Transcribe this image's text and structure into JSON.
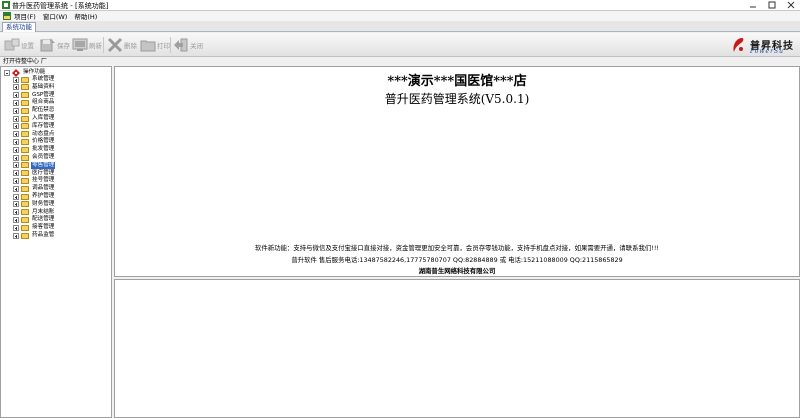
{
  "window": {
    "title": "普升医药管理系统 - [系统功能]"
  },
  "menubar": {
    "items": [
      "项目(F)",
      "窗口(W)",
      "帮助(H)"
    ]
  },
  "tabs": [
    "系统功能"
  ],
  "toolbar": {
    "buttons": [
      "设置",
      "保存",
      "刷新",
      "删除",
      "打印",
      "关闭"
    ]
  },
  "brand": {
    "name_cn": "普昇科技",
    "name_en": "PowerSu"
  },
  "tree": {
    "header": "打开待整中心 厂",
    "root": "操作功能",
    "items": [
      "系统管理",
      "基础资料",
      "GSP管理",
      "组合商品",
      "配伍禁忌",
      "入库管理",
      "库存管理",
      "动态盘点",
      "价格管理",
      "批发管理",
      "会员管理",
      "零售管理",
      "医疗管理",
      "挂号管理",
      "调品管理",
      "养护管理",
      "财务管理",
      "月末结账",
      "配送管理",
      "接客管理",
      "药品监管"
    ],
    "selected_index": 11
  },
  "main": {
    "store_name": "***演示***国医馆***店",
    "system_name": "普升医药管理系统(V5.0.1)",
    "features": "软件新功能：支持与微信及支付宝接口直接对接，资金管理更加安全可靠，会员存零钱功能，支持手机盘点对接，如果需要开通，请联系我们!!!",
    "contact": "普升软件  售后服务电话:13487582246,17775780707 QQ:82884889 或 电话:15211088009 QQ:2115865829",
    "company": "湖南普生网络科技有限公司"
  },
  "colors": {
    "selection": "#3168c4",
    "folder": "#f4d25c",
    "brand_red": "#c81a1a",
    "brand_blue": "#1a4c9c"
  }
}
